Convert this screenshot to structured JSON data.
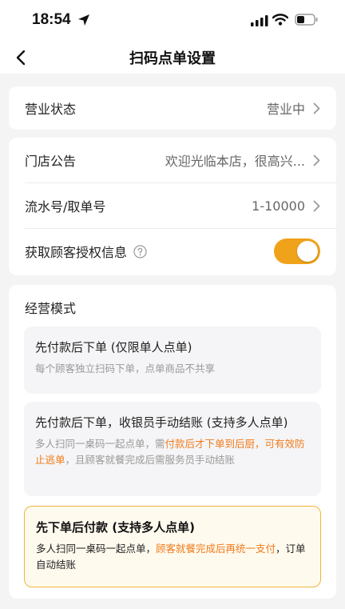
{
  "status_bar": {
    "time": "18:54"
  },
  "nav": {
    "title": "扫码点单设置"
  },
  "business_status": {
    "label": "营业状态",
    "value": "营业中"
  },
  "announcement": {
    "label": "门店公告",
    "value": "欢迎光临本店，很高兴..."
  },
  "serial_number": {
    "label": "流水号/取单号",
    "value": "1-10000"
  },
  "customer_auth": {
    "label": "获取顾客授权信息",
    "enabled": true
  },
  "modes": {
    "title": "经营模式",
    "items": [
      {
        "title": "先付款后下单 (仅限单人点单)",
        "desc": "每个顾客独立扫码下单，点单商品不共享"
      },
      {
        "title": "先付款后下单，收银员手动结账 (支持多人点单)",
        "desc_pre": "多人扫同一桌码一起点单，需",
        "desc_hl": "付款后才下单到后厨，可有效防止逃单",
        "desc_post": "，且顾客就餐完成后需服务员手动结账"
      },
      {
        "title": "先下单后付款 (支持多人点单)",
        "desc_pre": "多人扫同一桌码一起点单，",
        "desc_hl": "顾客就餐完成后再统一支付",
        "desc_post": "，订单自动结账",
        "selected": true
      }
    ]
  },
  "colors": {
    "accent": "#f0a21a",
    "highlight": "#f07a1a"
  }
}
